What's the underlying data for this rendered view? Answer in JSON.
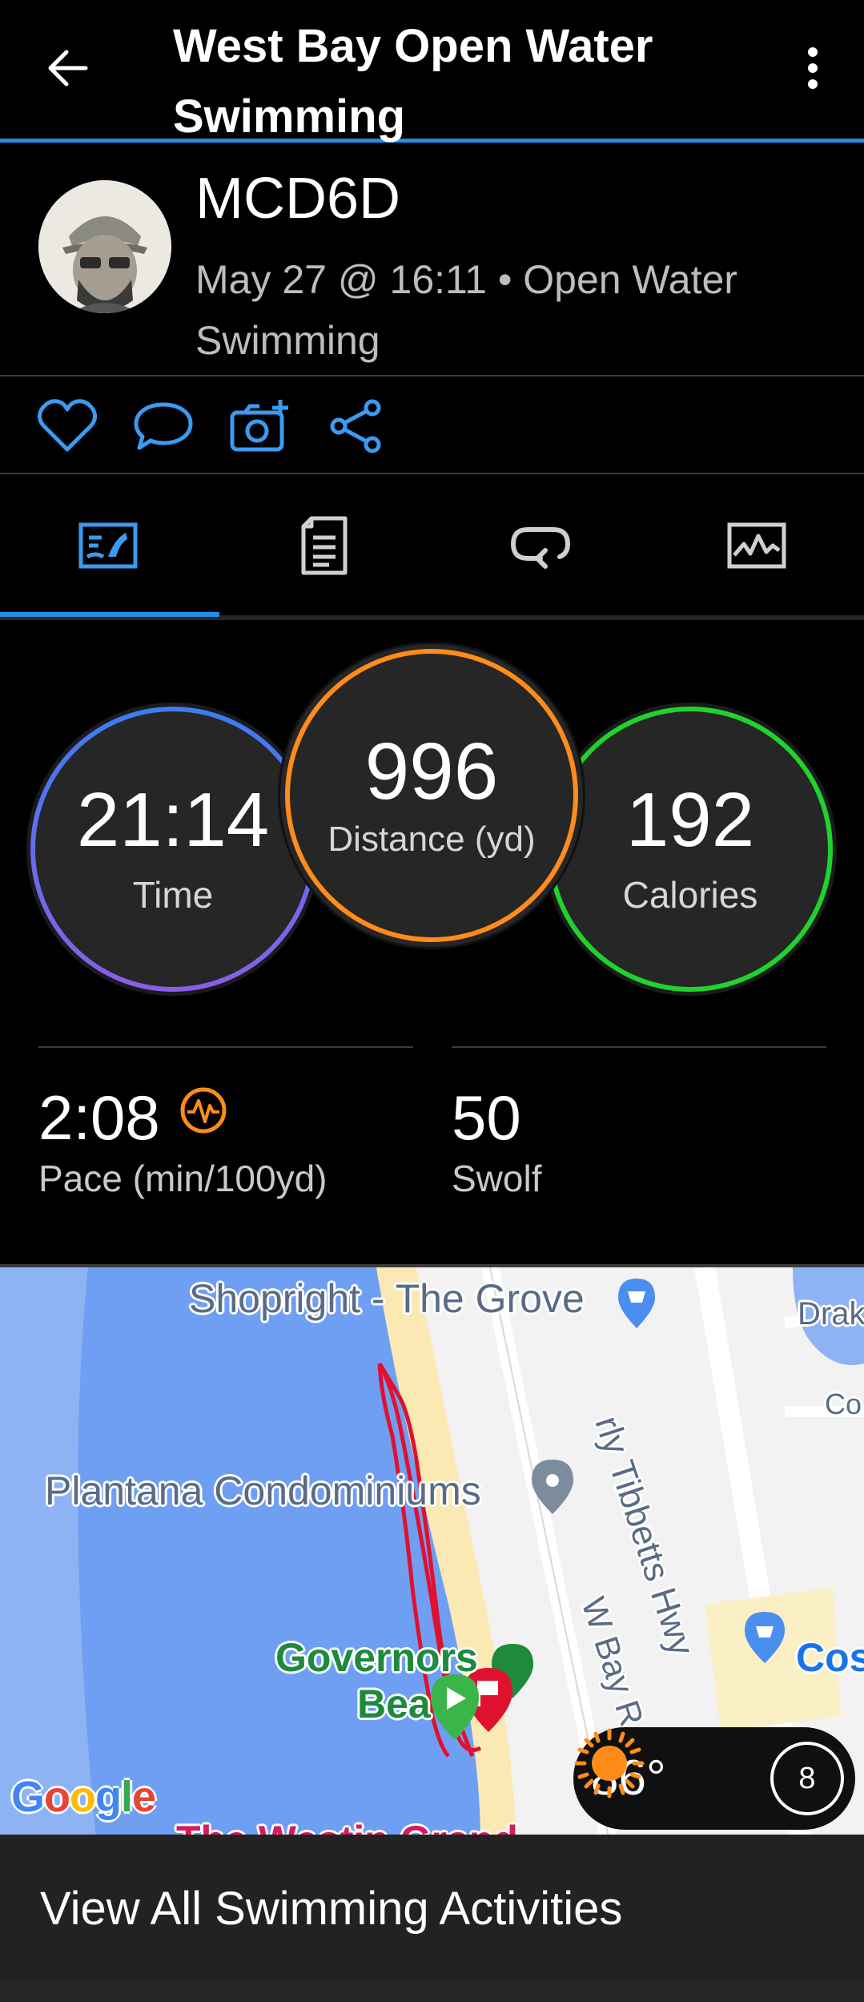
{
  "header": {
    "title": "West Bay Open Water Swimming"
  },
  "profile": {
    "username": "MCD6D",
    "date": "May 27 @ 16:11",
    "separator": "•",
    "activity_type": "Open Water Swimming"
  },
  "actions": [
    "heart-icon",
    "comment-icon",
    "add-photo-icon",
    "share-icon"
  ],
  "tabs": {
    "items": [
      "overview-icon",
      "details-icon",
      "laps-icon",
      "charts-icon"
    ],
    "active_index": 0
  },
  "stats": {
    "time": {
      "value": "21:14",
      "label": "Time"
    },
    "distance": {
      "value": "996",
      "label": "Distance (yd)"
    },
    "calories": {
      "value": "192",
      "label": "Calories"
    }
  },
  "metrics": {
    "pace": {
      "value": "2:08",
      "label": "Pace (min/100yd)"
    },
    "swolf": {
      "value": "50",
      "label": "Swolf"
    }
  },
  "map": {
    "labels": {
      "shopright": "Shopright - The Grove",
      "drak": "Drak",
      "co": "Co",
      "tibbetts": "rly Tibbetts Hwy",
      "plantana": "Plantana Condominiums",
      "wbay": "W Bay R",
      "governors1": "Governors",
      "governors2": "Bea",
      "cos": "Cos",
      "westin": "The Westin Grand"
    },
    "google": "Google",
    "weather": {
      "temperature": "86°",
      "wind": "8"
    }
  },
  "footer": {
    "view_all": "View All Swimming Activities"
  },
  "colors": {
    "accent": "#1f8fe6",
    "time_ring": "#8a5ee8",
    "distance_ring": "#ff8c1a",
    "calories_ring": "#1fd32c",
    "route": "#e0102f"
  }
}
